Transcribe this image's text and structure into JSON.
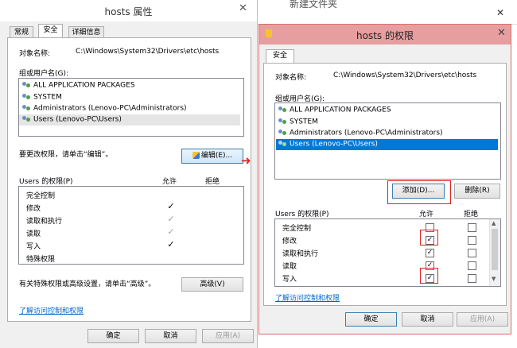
{
  "window1": {
    "title": "hosts 属性",
    "tabs": [
      "常规",
      "安全",
      "详细信息"
    ],
    "object_name_label": "对象名称:",
    "object_name_value": "C:\\Windows\\System32\\Drivers\\etc\\hosts",
    "group_label": "组或用户名(G):",
    "users": [
      "ALL APPLICATION PACKAGES",
      "SYSTEM",
      "Administrators (Lenovo-PC\\Administrators)",
      "Users (Lenovo-PC\\Users)"
    ],
    "change_hint": "要更改权限，请单击“编辑”。",
    "edit_button": "编辑(E)...",
    "perm_header": "Users 的权限(P)",
    "allow_header": "允许",
    "deny_header": "拒绝",
    "permissions": [
      "完全控制",
      "修改",
      "读取和执行",
      "读取",
      "写入",
      "特殊权限"
    ],
    "checkmark": "✓",
    "special_hint": "有关特殊权限或高级设置，请单击“高级”。",
    "advanced_button": "高级(V)",
    "learn_link": "了解访问控制和权限",
    "ok_button": "确定",
    "cancel_button": "取消",
    "apply_button": "应用(A)"
  },
  "background_window": {
    "title": "新建文件夹"
  },
  "window2": {
    "title": "hosts 的权限",
    "tab": "安全",
    "object_name_label": "对象名称:",
    "object_name_value": "C:\\Windows\\System32\\Drivers\\etc\\hosts",
    "group_label": "组或用户名(G):",
    "users": [
      "ALL APPLICATION PACKAGES",
      "SYSTEM",
      "Administrators (Lenovo-PC\\Administrators)",
      "Users (Lenovo-PC\\Users)"
    ],
    "add_button": "添加(D)...",
    "remove_button": "删除(R)",
    "perm_header": "Users 的权限(P)",
    "allow_header": "允许",
    "deny_header": "拒绝",
    "permissions": [
      "完全控制",
      "修改",
      "读取和执行",
      "读取",
      "写入"
    ],
    "check": "✓",
    "learn_link": "了解访问控制和权限",
    "ok_button": "确定",
    "cancel_button": "取消",
    "apply_button": "应用(A)"
  },
  "glyphs": {
    "close": "✕",
    "arrow": "➜",
    "scroll_up": "▲",
    "scroll_down": "▼"
  }
}
